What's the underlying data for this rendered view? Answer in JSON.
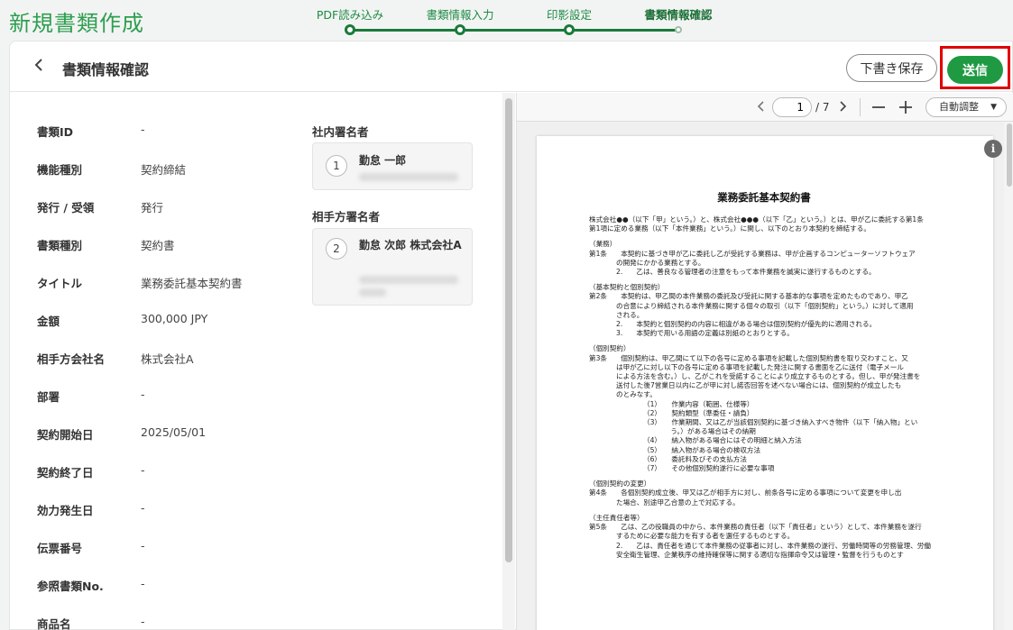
{
  "app": {
    "title": "新規書類作成"
  },
  "stepper": {
    "steps": [
      {
        "label": "PDF読み込み"
      },
      {
        "label": "書類情報入力"
      },
      {
        "label": "印影設定"
      },
      {
        "label": "書類情報確認"
      }
    ],
    "active_index": 3
  },
  "header": {
    "back_icon": "chevron-left-icon",
    "title": "書類情報確認",
    "draft_label": "下書き保存",
    "send_label": "送信"
  },
  "info": {
    "rows": [
      {
        "label": "書類ID",
        "value": "-"
      },
      {
        "label": "機能種別",
        "value": "契約締結"
      },
      {
        "label": "発行 / 受領",
        "value": "発行"
      },
      {
        "label": "書類種別",
        "value": "契約書"
      },
      {
        "label": "タイトル",
        "value": "業務委託基本契約書"
      },
      {
        "label": "金額",
        "value": "300,000 JPY"
      },
      {
        "label": "相手方会社名",
        "value": "株式会社A"
      },
      {
        "label": "部署",
        "value": "-"
      },
      {
        "label": "契約開始日",
        "value": "2025/05/01"
      },
      {
        "label": "契約終了日",
        "value": "-"
      },
      {
        "label": "効力発生日",
        "value": "-"
      },
      {
        "label": "伝票番号",
        "value": "-"
      },
      {
        "label": "参照書類No.",
        "value": "-"
      },
      {
        "label": "商品名",
        "value": "-"
      }
    ]
  },
  "signers": {
    "internal_title": "社内署名者",
    "internal": [
      {
        "num": "1",
        "name": "勤怠 一郎"
      }
    ],
    "external_title": "相手方署名者",
    "external": [
      {
        "num": "2",
        "name": "勤怠 次郎 株式会社A"
      }
    ]
  },
  "viewer": {
    "prev_icon": "chevron-left-icon",
    "next_icon": "chevron-right-icon",
    "current_page": "1",
    "total_pages": "/ 7",
    "zoom_out_icon": "minus-icon",
    "zoom_in_icon": "plus-icon",
    "zoom_label": "自動調整",
    "info_icon": "info-icon"
  },
  "document": {
    "title": "業務委託基本契約書",
    "lines": [
      {
        "text": "株式会社●●（以下「甲」という。）と、株式会社●●●（以下「乙」という。）とは、甲が乙に委託する第1条",
        "cls": ""
      },
      {
        "text": "第1項に定める業務（以下「本件業務」という。）に関し、以下のとおり本契約を締結する。",
        "cls": ""
      },
      {
        "text": "（業務）",
        "cls": "gap"
      },
      {
        "text": "第1条　　本契約に基づき甲が乙に委託し乙が受託する業務は、甲が企画するコンピューターソフトウェア",
        "cls": ""
      },
      {
        "text": "の開発にかかる業務とする。",
        "cls": "ind1"
      },
      {
        "text": "2.　　乙は、善良なる管理者の注意をもって本件業務を誠実に遂行するものとする。",
        "cls": "ind1"
      },
      {
        "text": "（基本契約と個別契約）",
        "cls": "gap"
      },
      {
        "text": "第2条　　本契約は、甲乙間の本件業務の委託及び受託に関する基本的な事項を定めたものであり、甲乙",
        "cls": ""
      },
      {
        "text": "の合意により締結される本件業務に関する個々の取引（以下「個別契約」という。）に対して適用",
        "cls": "ind1"
      },
      {
        "text": "される。",
        "cls": "ind1"
      },
      {
        "text": "2.　　本契約と個別契約の内容に相違がある場合は個別契約が優先的に適用される。",
        "cls": "ind1"
      },
      {
        "text": "3.　　本契約で用いる用語の定義は別紙のとおりとする。",
        "cls": "ind1"
      },
      {
        "text": "（個別契約）",
        "cls": "gap"
      },
      {
        "text": "第3条　　個別契約は、甲乙間にて以下の各号に定める事項を記載した個別契約書を取り交わすこと、又",
        "cls": ""
      },
      {
        "text": "は甲が乙に対し以下の各号に定める事項を記載した発注に関する書面を乙に送付（電子メール",
        "cls": "ind1"
      },
      {
        "text": "による方法を含む。）し、乙がこれを受諾することにより成立するものとする。但し、甲が発注書を",
        "cls": "ind1"
      },
      {
        "text": "送付した後7営業日以内に乙が甲に対し諾否回答を述べない場合には、個別契約が成立したも",
        "cls": "ind1"
      },
      {
        "text": "のとみなす。",
        "cls": "ind1"
      },
      {
        "text": "（1）　　作業内容（範囲、仕様等）",
        "cls": "ind3"
      },
      {
        "text": "（2）　　契約類型（準委任・請負）",
        "cls": "ind3"
      },
      {
        "text": "（3）　　作業期間、又は乙が当該個別契約に基づき納入すべき物件（以下「納入物」とい",
        "cls": "ind3"
      },
      {
        "text": "　　　　う。）がある場合はその納期",
        "cls": "ind3"
      },
      {
        "text": "（4）　　納入物がある場合にはその明細と納入方法",
        "cls": "ind3"
      },
      {
        "text": "（5）　　納入物がある場合の検収方法",
        "cls": "ind3"
      },
      {
        "text": "（6）　　委託料及びその支払方法",
        "cls": "ind3"
      },
      {
        "text": "（7）　　その他個別契約遂行に必要な事項",
        "cls": "ind3"
      },
      {
        "text": "（個別契約の変更）",
        "cls": "gap"
      },
      {
        "text": "第4条　　各個別契約成立後、甲又は乙が相手方に対し、前条各号に定める事項について変更を申し出",
        "cls": ""
      },
      {
        "text": "た場合、別途甲乙合意の上で対応する。",
        "cls": "ind1"
      },
      {
        "text": "（主任責任者等）",
        "cls": "gap"
      },
      {
        "text": "第5条　　乙は、乙の役職員の中から、本件業務の責任者（以下「責任者」という）として、本件業務を遂行",
        "cls": ""
      },
      {
        "text": "するために必要な能力を有する者を選任するものとする。",
        "cls": "ind1"
      },
      {
        "text": "2.　　乙は、責任者を通じて本件業務の従事者に対し、本件業務の遂行、労働時間等の労務管理、労働",
        "cls": "ind1"
      },
      {
        "text": "安全衛生管理、企業秩序の維持確保等に関する適切な指揮命令又は管理・監督を行うものとす",
        "cls": "ind1"
      }
    ]
  }
}
